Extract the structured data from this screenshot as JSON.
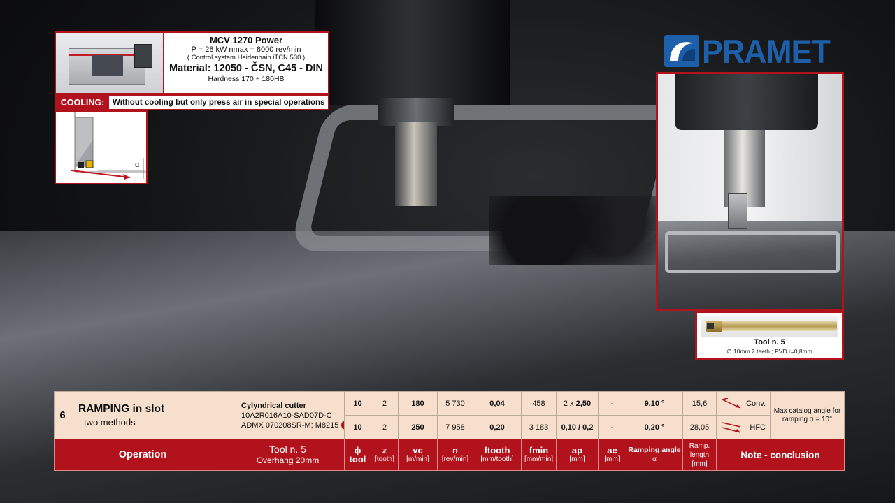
{
  "machine": {
    "title": "MCV 1270 Power",
    "spec": "P = 28 kW  nmax = 8000 rev/min",
    "control": "( Control  system  Heidenhain iTCN 530 )",
    "material": "Material:   12050 - ČSN,  C45 - DIN",
    "hardness": "Hardness 170 ÷ 180HB"
  },
  "cooling": {
    "label": "COOLING:",
    "text": "Without cooling but only press air in special operations"
  },
  "diagram": {
    "angle_symbol": "α"
  },
  "brand": {
    "name": "PRAMET",
    "color": "#1d5fa8"
  },
  "tool_card": {
    "title": "Tool n. 5",
    "spec": "∅ 10mm 2 teeth ; PVD  r=0,8mm"
  },
  "table": {
    "op_number": "6",
    "op_title": "RAMPING in slot",
    "op_subtitle": "- two methods",
    "tool_name": "Cylyndrical cutter",
    "tool_code": "10A2R016A10-SAD07D-C",
    "insert_code": "ADMX 070208SR-M; M8215",
    "rows": [
      {
        "phi": "10",
        "z": "2",
        "vc": "180",
        "n": "5 730",
        "ftooth": "0,04",
        "fmin": "458",
        "ap_prefix": "2 x ",
        "ap": "2,50",
        "ae": "-",
        "ramp_angle": "9,10 °",
        "ramp_length": "15,6",
        "method": "Conv."
      },
      {
        "phi": "10",
        "z": "2",
        "vc": "250",
        "n": "7 958",
        "ftooth": "0,20",
        "fmin": "3 183",
        "ap_prefix": "",
        "ap": "0,10  / 0,2",
        "ae": "-",
        "ramp_angle": "0,20 °",
        "ramp_length": "28,05",
        "method": "HFC"
      }
    ],
    "note": "Max catalog angle for ramping α = 10°",
    "headers": {
      "operation": "Operation",
      "tool": "Tool  n. 5",
      "tool_sub": "Overhang 20mm",
      "phi": "ϕ",
      "phi_sub": "tool",
      "z": "z",
      "z_unit": "[tooth]",
      "vc": "vc",
      "vc_unit": "[m/min]",
      "n": "n",
      "n_unit": "[rev/min]",
      "ftooth": "ftooth",
      "ftooth_unit": "[mm/tooth]",
      "fmin": "fmin",
      "fmin_unit": "[mm/min]",
      "ap": "ap",
      "ap_unit": "[mm]",
      "ae": "ae",
      "ae_unit": "[mm]",
      "ramp_angle": "Ramping angle",
      "ramp_angle_sub": "α",
      "ramp_length": "Ramp. length",
      "ramp_length_unit": "[mm]",
      "note": "Note - conclusion"
    }
  },
  "colors": {
    "accent_red": "#b2121b",
    "table_bg": "#f6dfcc"
  }
}
